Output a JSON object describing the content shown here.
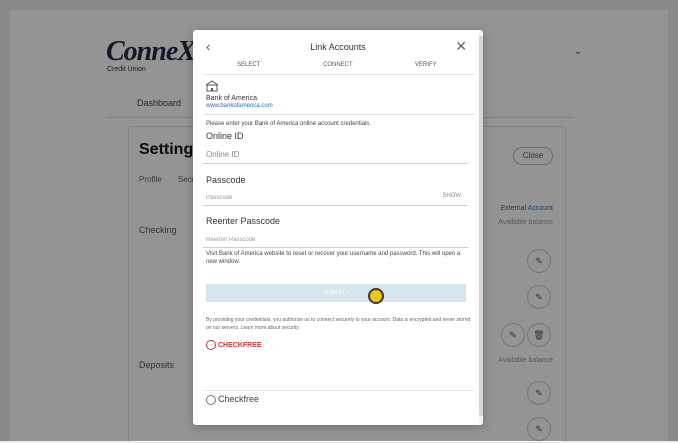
{
  "app": {
    "logo_text": "ConneXus",
    "logo_sub": "Credit Union",
    "nav_item": "Dashboard",
    "chevron": "⌄",
    "settings_title": "Settings",
    "settings_button": "Close",
    "settings_tabs": [
      "Profile",
      "Security"
    ],
    "rows": [
      "Checking",
      "Deposits"
    ],
    "column_heading": "External Account",
    "column_sub": "Available balance",
    "edit_glyph": "✎",
    "delete_glyph": "🗑"
  },
  "modal": {
    "back": "‹",
    "title": "Link Accounts",
    "close": "✕",
    "steps": [
      "SELECT",
      "CONNECT",
      "VERIFY"
    ],
    "bank_name": "Bank of America",
    "bank_link": "www.bankofamerica.com",
    "instruction": "Please enter your Bank of America online account credentials.",
    "fields": {
      "online_id_label": "Online ID",
      "online_id_placeholder": "Online ID",
      "passcode_label": "Passcode",
      "passcode_placeholder": "Passcode",
      "show": "SHOW",
      "reenter_label": "Reenter Passcode",
      "reenter_placeholder": "Reenter Passcode"
    },
    "note": "Visit Bank of America website to reset or recover your username and password. This will open a new window.",
    "submit": "SUBMIT ›",
    "fineprint": "By providing your credentials, you authorize us to connect securely to your account. Data is encrypted and never stored on our servers. Learn more about security.",
    "partner_logo": "CHECKFREE",
    "footer_brand": "Checkfree"
  }
}
